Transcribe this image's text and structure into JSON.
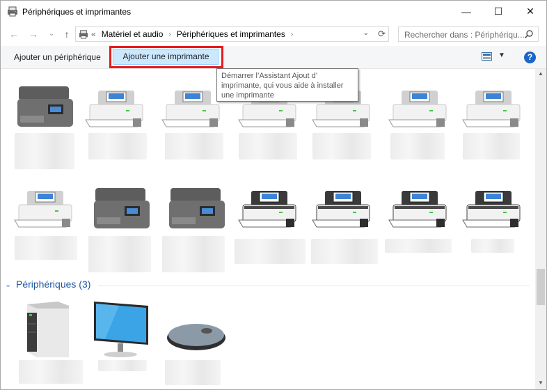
{
  "window": {
    "title": "Périphériques et imprimantes",
    "controls": {
      "minimize": "—",
      "maximize": "☐",
      "close": "✕"
    }
  },
  "nav": {
    "back": "←",
    "forward": "→",
    "recent": "⌄",
    "up": "↑",
    "breadcrumb": {
      "lead": "«",
      "items": [
        "Matériel et audio",
        "Périphériques et imprimantes"
      ],
      "separator": "›"
    },
    "dropdown": "⌄",
    "refresh": "⟳",
    "search_placeholder": "Rechercher dans : Périphériqu..."
  },
  "toolbar": {
    "add_device": "Ajouter un périphérique",
    "add_printer": "Ajouter une imprimante",
    "view_dropdown": "▼",
    "help": "?"
  },
  "tooltip": {
    "text": "Démarrer l’Assistant Ajout d’ imprimante, qui vous aide à installer une imprimante"
  },
  "groups": [
    {
      "title": "Périphériques (3)",
      "expanded": true
    }
  ],
  "colors": {
    "highlight_border": "#e81b1b",
    "selected_bg": "#cce8ff",
    "group_title": "#1e56a0",
    "help_icon": "#1a66c8"
  },
  "icons": {
    "printer_light": "printer-icon",
    "printer_dark": "printer-dark-icon",
    "mfp": "multifunction-printer-icon",
    "tower": "computer-tower-icon",
    "monitor": "monitor-icon",
    "mouse": "mouse-icon"
  }
}
